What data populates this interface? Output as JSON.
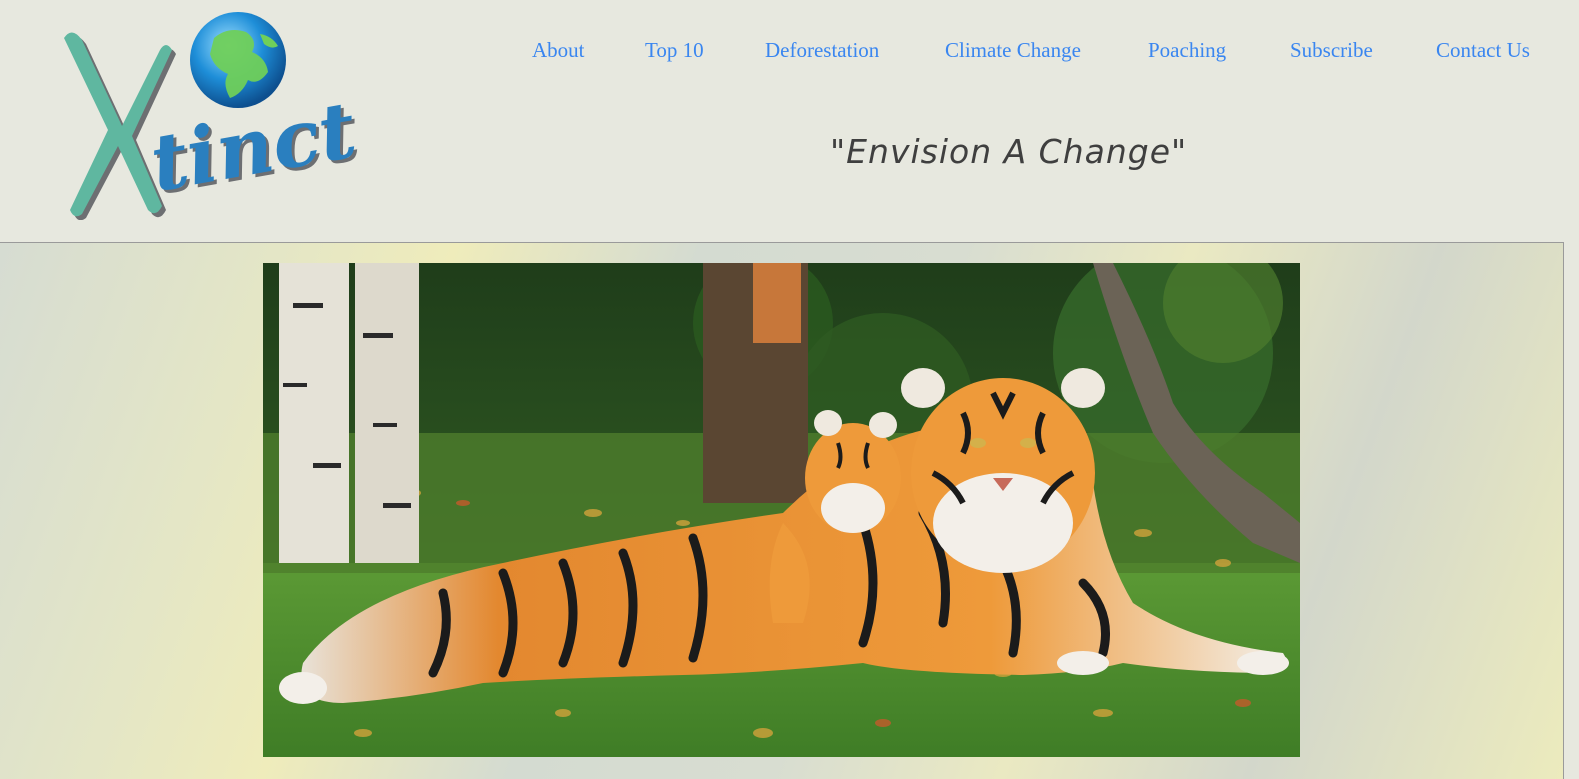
{
  "brand": {
    "logo_text": "Xtinct",
    "logo_icon": "globe-icon"
  },
  "nav": {
    "items": [
      {
        "label": "About"
      },
      {
        "label": "Top 10"
      },
      {
        "label": "Deforestation"
      },
      {
        "label": "Climate Change"
      },
      {
        "label": "Poaching"
      },
      {
        "label": "Subscribe"
      },
      {
        "label": "Contact Us"
      }
    ]
  },
  "tagline": "\"Envision A Change\"",
  "hero": {
    "image": "tiger-with-cub-photo"
  },
  "colors": {
    "background": "#e7e8df",
    "link": "#3a86f0",
    "tagline": "#3f3f3f",
    "logo_teal": "#5fb7a0",
    "logo_blue": "#2a7fbf"
  }
}
